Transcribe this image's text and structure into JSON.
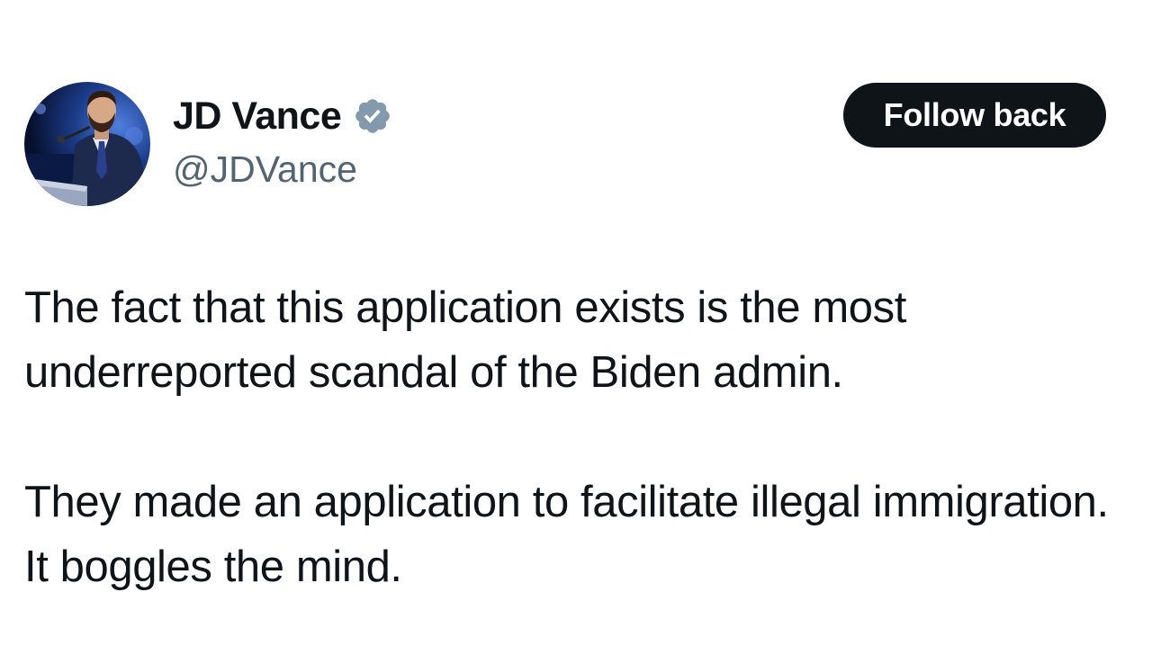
{
  "author": {
    "display_name": "JD Vance",
    "handle": "@JDVance",
    "verified_icon": "verified-badge-icon",
    "verified_color": "#829aab"
  },
  "actions": {
    "follow_label": "Follow back"
  },
  "tweet": {
    "paragraphs": [
      "The fact that this application exists is the most underreported scandal of the Biden admin.",
      "They made an application to facilitate illegal immigration.  It boggles the mind."
    ]
  },
  "colors": {
    "text": "#0f1419",
    "secondary_text": "#536471",
    "button_bg": "#0f1419",
    "button_text": "#ffffff",
    "background": "#ffffff"
  }
}
